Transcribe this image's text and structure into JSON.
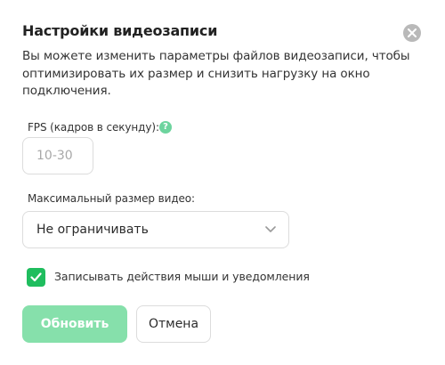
{
  "dialog": {
    "title": "Настройки видеозаписи",
    "description": "Вы можете изменить параметры файлов видеозаписи, чтобы оптимизировать их размер и снизить нагрузку на окно подключения.",
    "close_icon": "close-icon"
  },
  "fps": {
    "label": "FPS (кадров в секунду):",
    "help_icon": "help-icon",
    "help_glyph": "?",
    "placeholder": "10-30",
    "value": ""
  },
  "video_size": {
    "label": "Максимальный размер видео:",
    "selected": "Не ограничивать",
    "icon": "chevron-down-icon"
  },
  "record_actions": {
    "checked": true,
    "label": "Записывать действия мыши и уведомления"
  },
  "buttons": {
    "update": "Обновить",
    "cancel": "Отмена"
  },
  "colors": {
    "accent": "#1fbd5e",
    "update_button": "#86e0ab",
    "help_icon": "#6dd49e",
    "close_icon": "#b9b9b9",
    "border": "#dcdcdc"
  }
}
